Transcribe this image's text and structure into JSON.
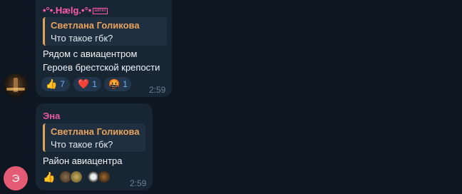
{
  "messages": [
    {
      "sender": "•°•.Hælg.•°•",
      "admin_badge": "admin",
      "reply_to": {
        "name": "Светлана Голикова",
        "text": "Что такое гбк?"
      },
      "text_lines": [
        "Рядом с авиацентром",
        "Героев брестской крепости"
      ],
      "reactions": [
        {
          "emoji": "👍",
          "count": "7"
        },
        {
          "emoji": "❤️",
          "count": "1"
        },
        {
          "emoji": "🤬",
          "count": "1"
        }
      ],
      "time": "2:59"
    },
    {
      "sender": "Эна",
      "reply_to": {
        "name": "Светлана Голикова",
        "text": "Что такое гбк?"
      },
      "text_lines": [
        "Район авиацентра"
      ],
      "reactions": [
        {
          "emoji": "👍"
        }
      ],
      "time": "2:59"
    }
  ],
  "avatars": {
    "second_initial": "Э"
  },
  "colors": {
    "background": "#0e1621",
    "bubble": "#182533",
    "sender1": "#ff5aa8",
    "sender2": "#e85aa0",
    "reply_accent": "#e0a15b",
    "reaction_count": "#6ab3f3"
  }
}
